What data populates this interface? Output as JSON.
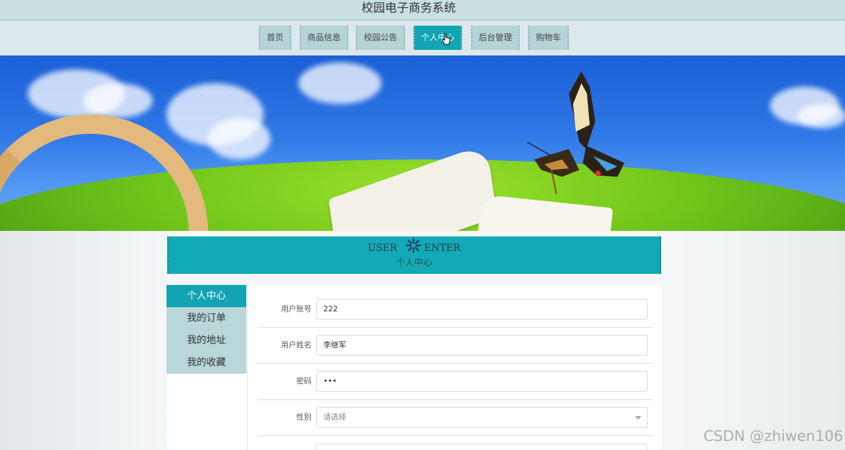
{
  "header": {
    "site_title": "校园电子商务系统"
  },
  "nav": {
    "items": [
      {
        "label": "首页"
      },
      {
        "label": "商品信息"
      },
      {
        "label": "校园公告"
      },
      {
        "label": "个人中心"
      },
      {
        "label": "后台管理"
      },
      {
        "label": "购物车"
      }
    ],
    "active_index": 3
  },
  "section": {
    "title_en_left": "USER",
    "title_en_right": "ENTER",
    "title_cn": "个人中心"
  },
  "sidemenu": {
    "items": [
      {
        "label": "个人中心"
      },
      {
        "label": "我的订单"
      },
      {
        "label": "我的地址"
      },
      {
        "label": "我的收藏"
      }
    ],
    "active_index": 0
  },
  "form": {
    "account": {
      "label": "用户账号",
      "value": "222"
    },
    "name": {
      "label": "用户姓名",
      "value": "李继军"
    },
    "password": {
      "label": "密码",
      "value": "•••"
    },
    "gender": {
      "label": "性别",
      "value": "请选择"
    }
  },
  "watermark": "CSDN @zhiwen106",
  "colors": {
    "accent": "#13a4b3",
    "nav_bg": "#b6d3d6",
    "topbar": "#c9dfe2"
  },
  "icons": {
    "cursor": "hand-pointer-icon",
    "loader": "loading-spinner-icon"
  }
}
